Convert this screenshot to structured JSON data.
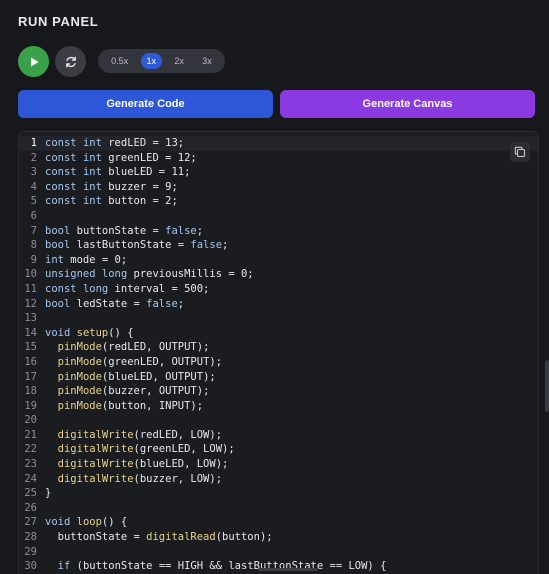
{
  "panel": {
    "title": "RUN PANEL"
  },
  "controls": {
    "speeds": [
      "0.5x",
      "1x",
      "2x",
      "3x"
    ],
    "selected_speed": "1x"
  },
  "buttons": {
    "generate_code": "Generate Code",
    "generate_canvas": "Generate Canvas"
  },
  "colors": {
    "play": "#3aa14a",
    "generate_code": "#2d57d6",
    "generate_canvas": "#8a3ae0",
    "speed_active": "#2f5bd8"
  },
  "editor": {
    "current_line": 1,
    "lines": [
      "const int redLED = 13;",
      "const int greenLED = 12;",
      "const int blueLED = 11;",
      "const int buzzer = 9;",
      "const int button = 2;",
      "",
      "bool buttonState = false;",
      "bool lastButtonState = false;",
      "int mode = 0;",
      "unsigned long previousMillis = 0;",
      "const long interval = 500;",
      "bool ledState = false;",
      "",
      "void setup() {",
      "  pinMode(redLED, OUTPUT);",
      "  pinMode(greenLED, OUTPUT);",
      "  pinMode(blueLED, OUTPUT);",
      "  pinMode(buzzer, OUTPUT);",
      "  pinMode(button, INPUT);",
      "",
      "  digitalWrite(redLED, LOW);",
      "  digitalWrite(greenLED, LOW);",
      "  digitalWrite(blueLED, LOW);",
      "  digitalWrite(buzzer, LOW);",
      "}",
      "",
      "void loop() {",
      "  buttonState = digitalRead(button);",
      "",
      "  if (buttonState == HIGH && lastButtonState == LOW) {"
    ]
  }
}
